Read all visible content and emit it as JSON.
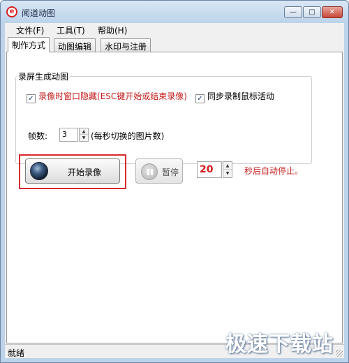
{
  "window": {
    "title": "闻道动图",
    "app_icon_glyph": "e",
    "min_glyph": "—",
    "max_glyph": "□",
    "close_glyph": "✕"
  },
  "menu": {
    "items": [
      "文件(F)",
      "工具(T)",
      "帮助(H)"
    ]
  },
  "tabs": [
    {
      "label": "制作方式",
      "active": true
    },
    {
      "label": "动图编辑",
      "active": false
    },
    {
      "label": "水印与注册",
      "active": false
    }
  ],
  "record_group": {
    "title": "录屏生成动图",
    "hide_window_checkbox": {
      "checked": true,
      "label": "录像时窗口隐藏(ESC键开始或结束录像)"
    },
    "record_mouse_checkbox": {
      "checked": true,
      "label": "同步录制鼠标活动"
    },
    "fps_label": "帧数:",
    "fps_value": "3",
    "fps_hint": "(每秒切换的图片数)",
    "start_button_label": "开始录像",
    "pause_button_label": "暂停",
    "auto_stop_seconds": "20",
    "auto_stop_label": "秒后自动停止。"
  },
  "icons": {
    "check": "✓",
    "spin_up": "▲",
    "spin_down": "▼"
  },
  "status_bar": {
    "text": "就绪"
  },
  "watermark": {
    "text": "极速下载站"
  },
  "colors": {
    "highlight": "#d62a2a",
    "accent_red": "#c41e1e",
    "frame": "#bcd3ea"
  }
}
